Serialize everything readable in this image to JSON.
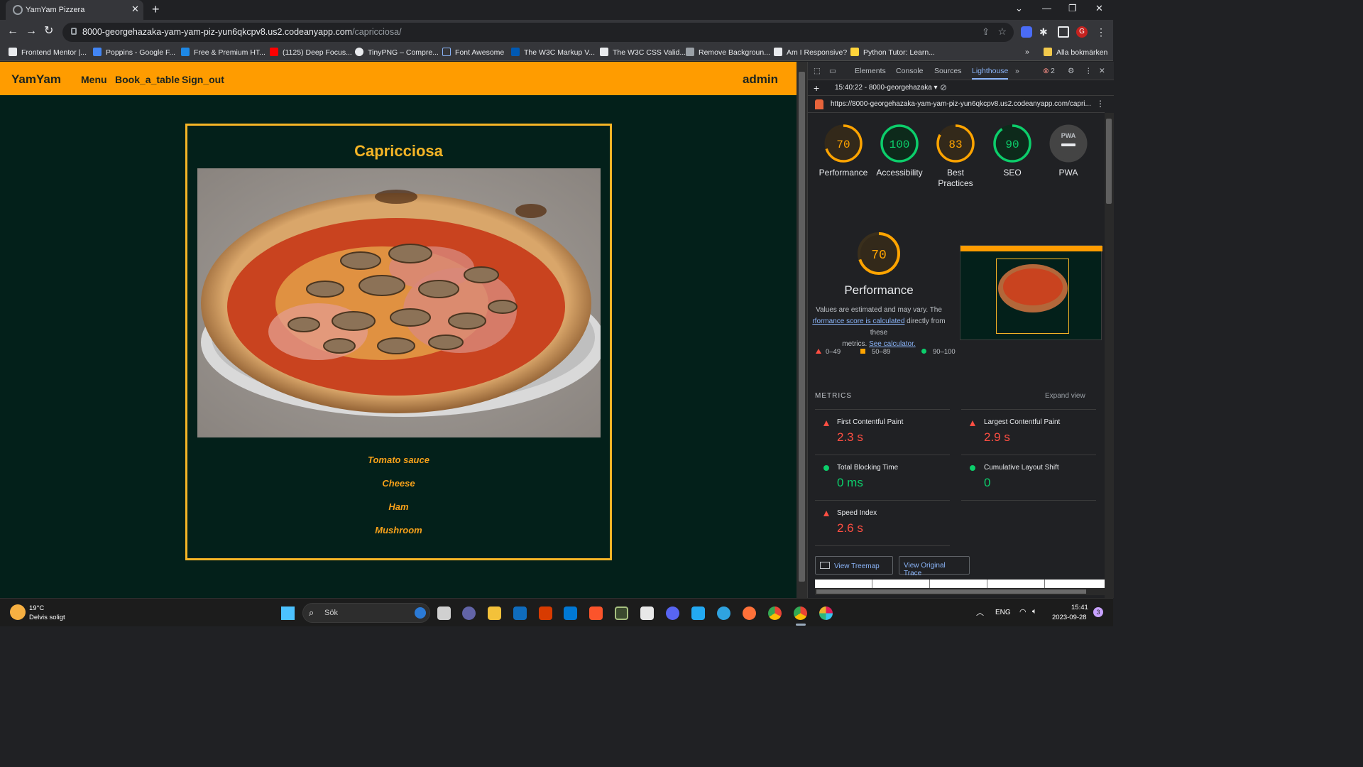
{
  "browser": {
    "tab_title": "YamYam Pizzera",
    "url_host": "8000-georgehazaka-yam-yam-piz-yun6qkcpv8.us2.codeanyapp.com",
    "url_path": "/capricciosa/",
    "bookmarks": [
      "Frontend Mentor |...",
      "Poppins - Google F...",
      "Free & Premium HT...",
      "(1125) Deep Focus...",
      "TinyPNG – Compre...",
      "Font Awesome",
      "The W3C Markup V...",
      "The W3C CSS Valid...",
      "Remove Backgroun...",
      "Am I Responsive?",
      "Python Tutor: Learn..."
    ],
    "all_bookmarks": "Alla bokmärken"
  },
  "site": {
    "brand": "YamYam",
    "nav": [
      "Menu",
      "Book_a_table",
      "Sign_out"
    ],
    "user": "admin",
    "pizza_name": "Capricciosa",
    "ingredients": [
      "Tomato sauce",
      "Cheese",
      "Ham",
      "Mushroom"
    ]
  },
  "devtools": {
    "tabs": [
      "Elements",
      "Console",
      "Sources",
      "Lighthouse"
    ],
    "error_count": "2",
    "report_time": "15:40:22 - 8000-georgehazaka",
    "report_url": "https://8000-georgehazaka-yam-yam-piz-yun6qkcpv8.us2.codeanyapp.com/capri...",
    "scores": [
      {
        "label": "Performance",
        "value": 70,
        "text": "70"
      },
      {
        "label": "Accessibility",
        "value": 100,
        "text": "100"
      },
      {
        "label": "Best Practices",
        "value": 83,
        "text": "83"
      },
      {
        "label": "SEO",
        "value": 90,
        "text": "90"
      },
      {
        "label": "PWA",
        "value": 0,
        "text": "PWA"
      }
    ],
    "perf_title": "Performance",
    "perf_note_1": "Values are estimated and may vary. The",
    "perf_link": "rformance score is calculated",
    "perf_note_2": " directly from these",
    "perf_note_3": "metrics. ",
    "perf_calc": "See calculator.",
    "legend": [
      "0–49",
      "50–89",
      "90–100"
    ],
    "metrics_heading": "METRICS",
    "expand_view": "Expand view",
    "metrics": [
      {
        "label": "First Contentful Paint",
        "value": "2.3 s",
        "status": "fail"
      },
      {
        "label": "Largest Contentful Paint",
        "value": "2.9 s",
        "status": "fail"
      },
      {
        "label": "Total Blocking Time",
        "value": "0 ms",
        "status": "pass"
      },
      {
        "label": "Cumulative Layout Shift",
        "value": "0",
        "status": "pass"
      },
      {
        "label": "Speed Index",
        "value": "2.6 s",
        "status": "fail"
      }
    ],
    "btn_treemap": "View Treemap",
    "btn_trace": "View Original Trace"
  },
  "taskbar": {
    "temp": "19°C",
    "weather": "Delvis soligt",
    "search": "Sök",
    "lang": "ENG",
    "time": "15:41",
    "date": "2023-09-28",
    "notifications": "3"
  },
  "colors": {
    "nav_bg": "#ff9c00",
    "page_bg": "#03201a",
    "accent": "#f6b526",
    "good": "#0cce6b",
    "average": "#ffa400",
    "poor": "#ff4e42"
  }
}
